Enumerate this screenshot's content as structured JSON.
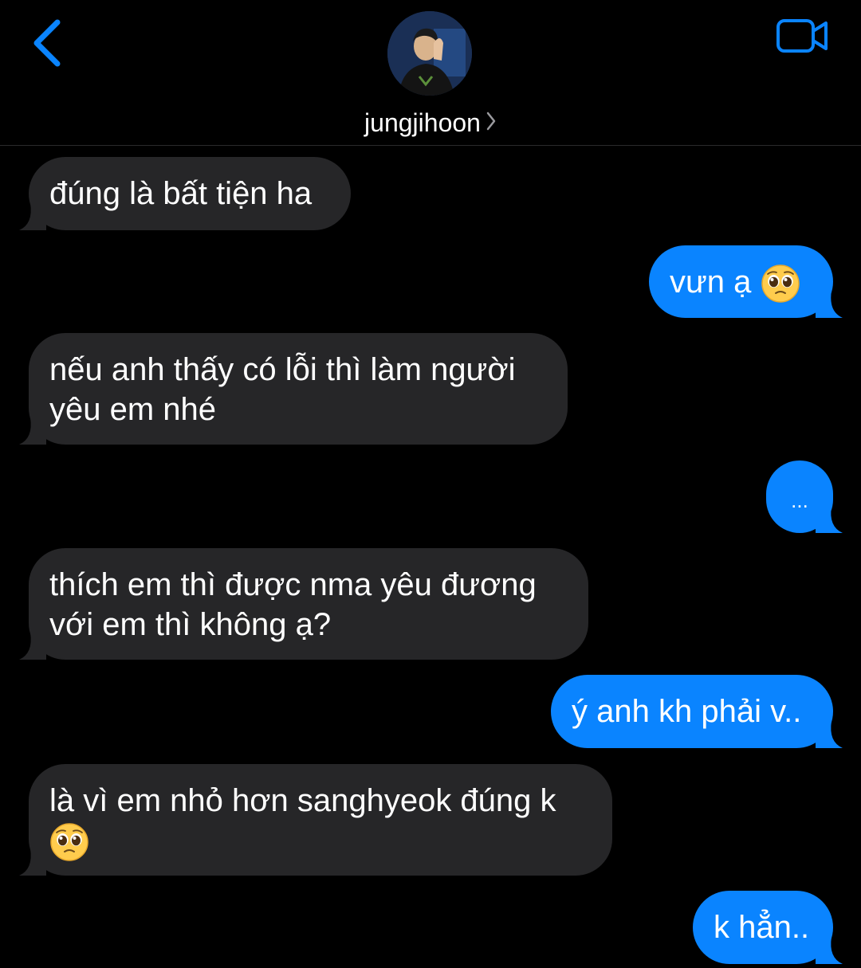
{
  "header": {
    "contact_name": "jungjihoon",
    "back_icon": "chevron-left-icon",
    "video_icon": "video-camera-icon",
    "accent_color": "#0A84FF"
  },
  "messages": [
    {
      "direction": "incoming",
      "text": "đúng là bất tiện ha"
    },
    {
      "direction": "outgoing",
      "text": "vưn ạ",
      "emoji": "pleading-face-emoji"
    },
    {
      "direction": "incoming",
      "text": "nếu anh thấy có lỗi thì làm người yêu em nhé"
    },
    {
      "direction": "outgoing",
      "text": "..."
    },
    {
      "direction": "incoming",
      "text": "thích em thì được nma yêu đương với em thì không ạ?"
    },
    {
      "direction": "outgoing",
      "text": "ý anh kh phải v.."
    },
    {
      "direction": "incoming",
      "text": "là vì em nhỏ hơn sanghyeok đúng k",
      "emoji": "pleading-face-emoji"
    },
    {
      "direction": "outgoing",
      "text": "k hẳn.."
    }
  ]
}
